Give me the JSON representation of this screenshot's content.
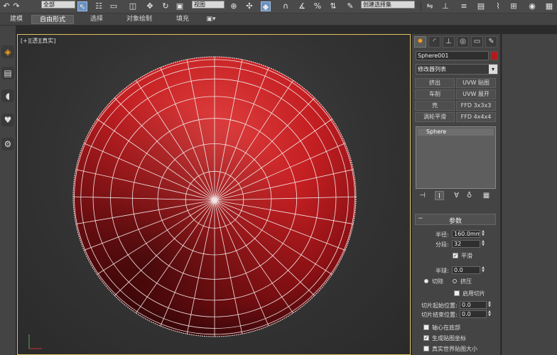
{
  "toolbar": {
    "selection_filter": "全部",
    "reference_coord": "视图",
    "named_selection": "创建选择集"
  },
  "ribbon": {
    "tabs": [
      {
        "label": "建模",
        "active": false
      },
      {
        "label": "自由形式",
        "active": true
      },
      {
        "label": "选择",
        "active": false
      },
      {
        "label": "对象绘制",
        "active": false
      },
      {
        "label": "填充",
        "active": false
      }
    ]
  },
  "viewport": {
    "label": "[+][透][真实]"
  },
  "sphere_object": {
    "color": "#b31a1a",
    "segments": 32
  },
  "command_panel": {
    "object_name": "Sphere001",
    "object_color": "#b31a1a",
    "modifier_list": "修改器列表",
    "modifier_buttons": [
      {
        "label": "挤出"
      },
      {
        "label": "UVW 贴图"
      },
      {
        "label": "车削"
      },
      {
        "label": "UVW 展开"
      },
      {
        "label": "壳"
      },
      {
        "label": "FFD 3x3x3"
      },
      {
        "label": "涡轮平滑"
      },
      {
        "label": "FFD 4x4x4"
      }
    ],
    "stack_item": "Sphere"
  },
  "params": {
    "title": "参数",
    "radius_label": "半径:",
    "radius_value": "160.0mm",
    "segments_label": "分段:",
    "segments_value": "32",
    "smooth_label": "平滑",
    "smooth_checked": true,
    "hemisphere_label": "半球:",
    "hemisphere_value": "0.0",
    "chop_label": "切除",
    "squash_label": "挤压",
    "chop_selected": true,
    "slice_on_label": "启用切片",
    "slice_on_checked": false,
    "slice_from_label": "切片起始位置:",
    "slice_from_value": "0.0",
    "slice_to_label": "切片结束位置:",
    "slice_to_value": "0.0",
    "base_to_pivot_label": "轴心在底部",
    "base_to_pivot_checked": false,
    "gen_map_label": "生成贴图坐标",
    "gen_map_checked": true,
    "real_world_label": "真实世界贴图大小",
    "real_world_checked": false
  }
}
